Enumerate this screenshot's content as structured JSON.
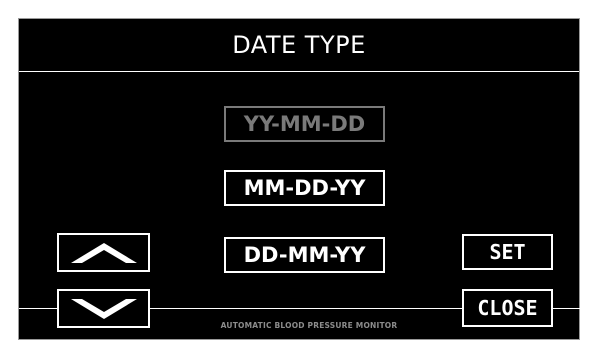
{
  "screen": {
    "title": "DATE TYPE"
  },
  "options": [
    {
      "label": "YY-MM-DD",
      "state": "disabled"
    },
    {
      "label": "MM-DD-YY",
      "state": "enabled"
    },
    {
      "label": "DD-MM-YY",
      "state": "enabled"
    }
  ],
  "controls": {
    "up_icon": "chevron-up-icon",
    "down_icon": "chevron-down-icon",
    "set_label": "SET",
    "close_label": "CLOSE"
  },
  "footer": {
    "text": "AUTOMATIC BLOOD PRESSURE MONITOR"
  },
  "colors": {
    "background": "#000000",
    "foreground": "#ffffff",
    "disabled": "#7a7a7a"
  }
}
